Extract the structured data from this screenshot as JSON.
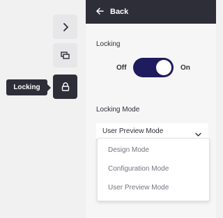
{
  "rail": {
    "buttons": [
      {
        "icon": "chevron-right-icon",
        "active": false
      },
      {
        "icon": "copy-icon",
        "active": false
      },
      {
        "icon": "lock-icon",
        "active": true
      }
    ],
    "tooltip": "Locking"
  },
  "panel": {
    "back_label": "Back",
    "locking_label": "Locking",
    "toggle": {
      "off_label": "Off",
      "on_label": "On",
      "state": "on"
    },
    "locking_mode_label": "Locking Mode",
    "select": {
      "value": "User Preview Mode",
      "options": [
        "Design Mode",
        "Configuration Mode",
        "User Preview Mode"
      ]
    }
  },
  "colors": {
    "dark": "#2e2e38",
    "toggle_on": "#1e1b5e",
    "background": "#f1f1f1",
    "panel": "#f6f6f6"
  }
}
